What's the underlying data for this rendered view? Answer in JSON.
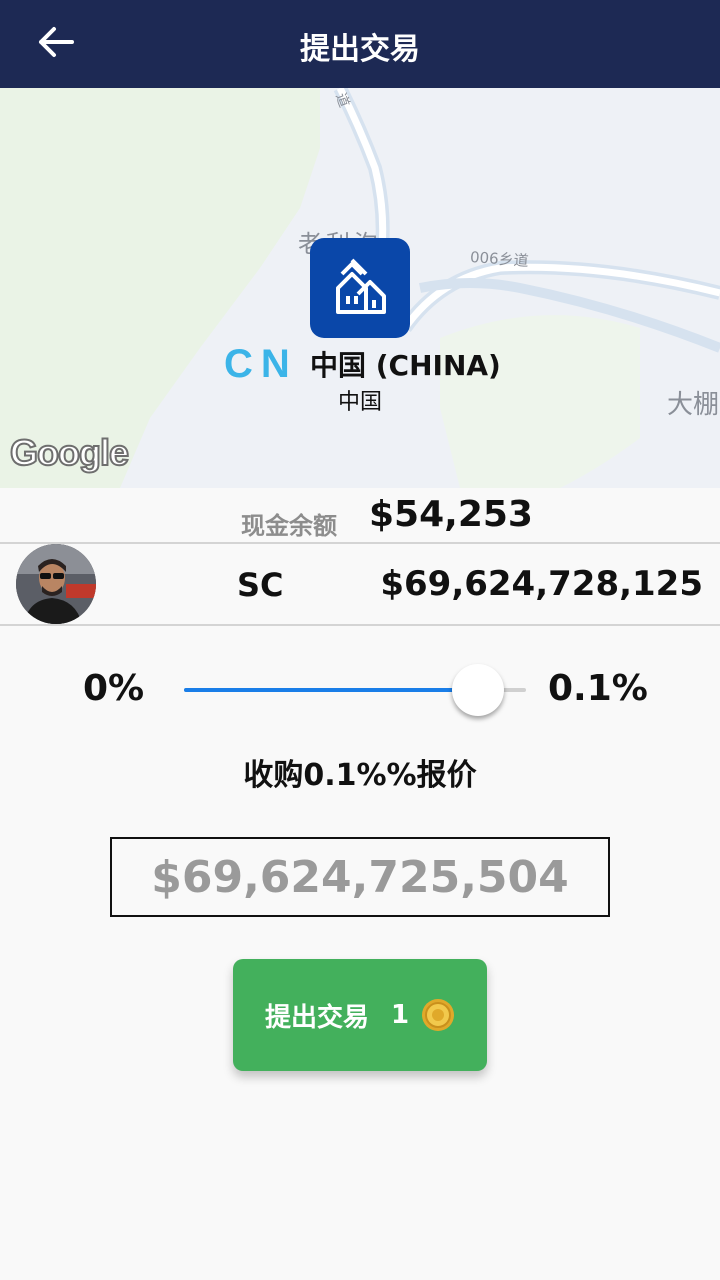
{
  "header": {
    "title": "提出交易",
    "back_icon": "arrow-left-icon"
  },
  "map": {
    "labels": {
      "village": "老利沟",
      "road_006": "006乡道",
      "road_top": "道",
      "town": "大棚"
    },
    "attribution": "Google",
    "marker_icon": "property-buildings-icon",
    "country_code": "CN",
    "country_name": "中国 (CHINA)",
    "country_sub": "中国"
  },
  "balance": {
    "label": "现金余额",
    "value": "$54,253"
  },
  "owner": {
    "code": "SC",
    "value": "$69,624,728,125"
  },
  "percent_slider": {
    "min_label": "0%",
    "max_label": "0.1%",
    "value_fraction": 0.86
  },
  "offer": {
    "caption": "收购0.1%%报价",
    "amount": "$69,624,725,504"
  },
  "submit": {
    "label": "提出交易",
    "count": "1",
    "coin_icon": "gold-coin-icon"
  },
  "colors": {
    "header_bg": "#1d2954",
    "marker_bg": "#0a47a9",
    "country_code": "#3bb4e8",
    "slider_fill": "#1a7ee8",
    "submit_bg": "#43b05c"
  }
}
